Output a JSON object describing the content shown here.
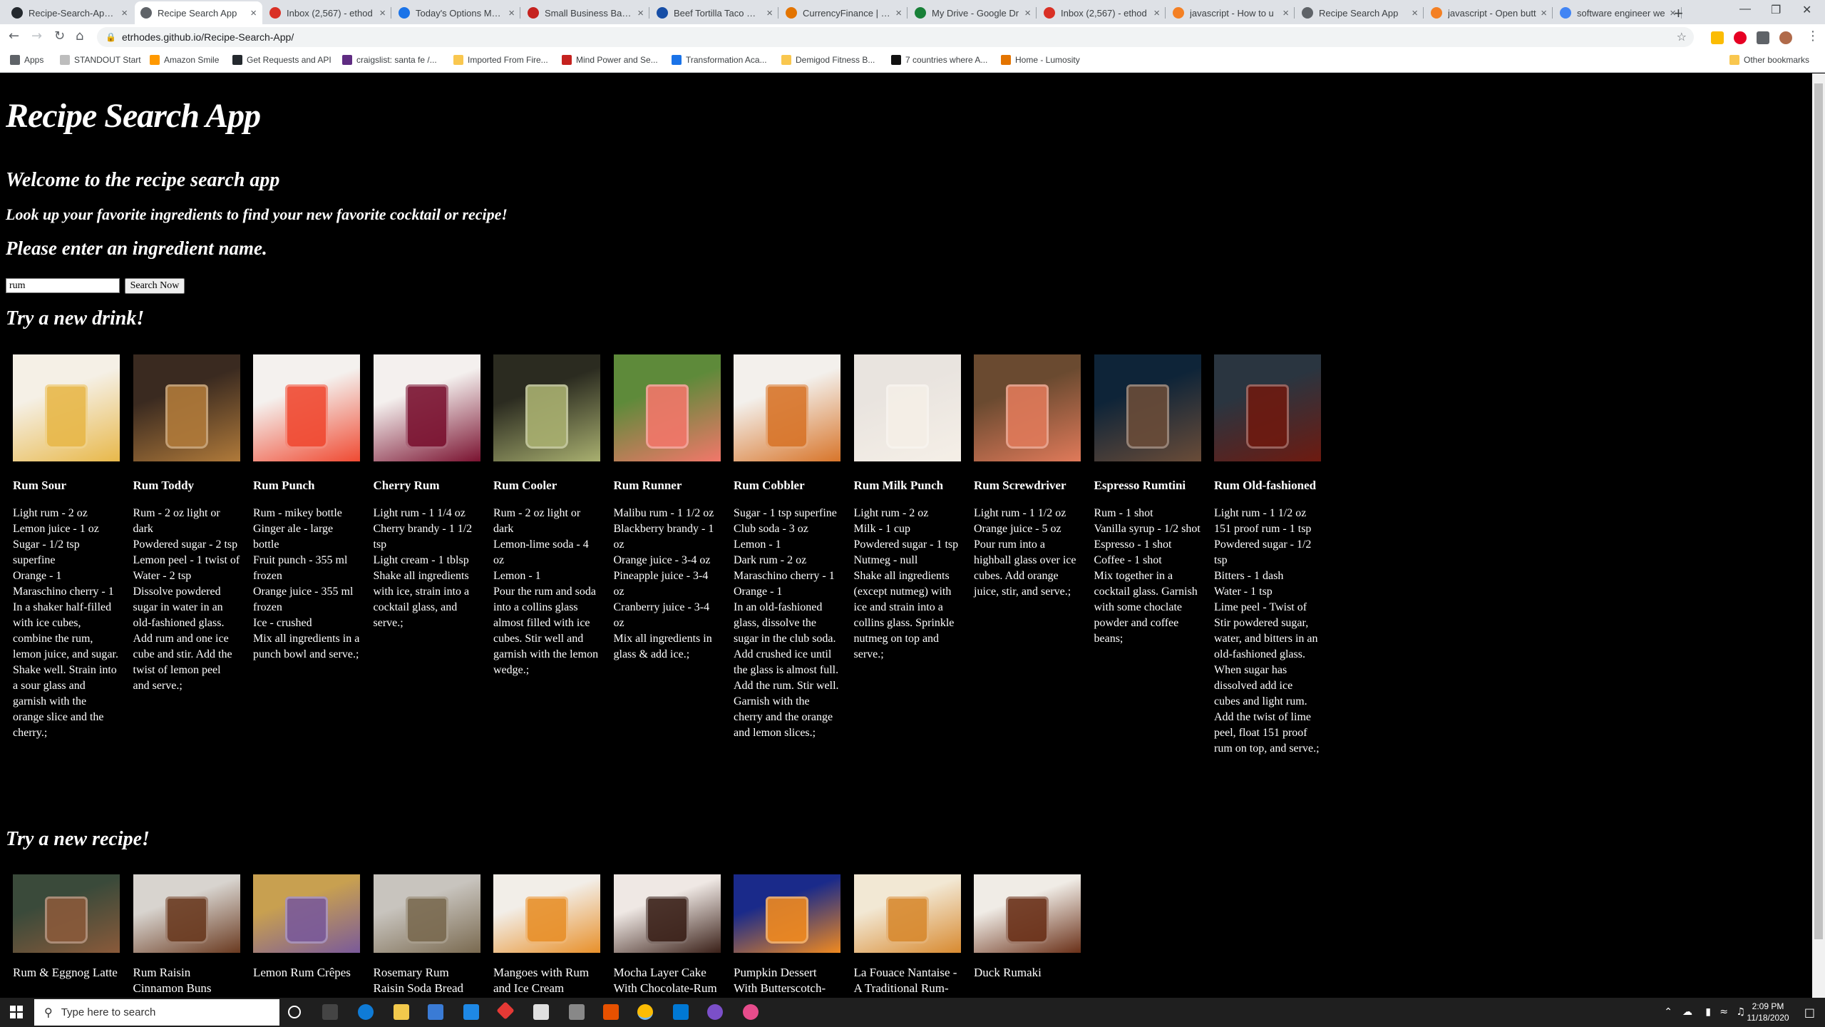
{
  "browser": {
    "tabs": [
      {
        "title": "Recipe-Search-App/R",
        "color": "#24292e"
      },
      {
        "title": "Recipe Search App",
        "color": "#5f6368"
      },
      {
        "title": "Inbox (2,567) - ethod",
        "color": "#d93025"
      },
      {
        "title": "Today's Options Mark",
        "color": "#1a73e8"
      },
      {
        "title": "Small Business Bankin",
        "color": "#c5221f"
      },
      {
        "title": "Beef Tortilla Taco Cas",
        "color": "#174ea6"
      },
      {
        "title": "CurrencyFinance | On",
        "color": "#e37400"
      },
      {
        "title": "My Drive - Google Dr",
        "color": "#188038"
      },
      {
        "title": "Inbox (2,567) - ethod",
        "color": "#d93025"
      },
      {
        "title": "javascript - How to u",
        "color": "#f48024"
      },
      {
        "title": "Recipe Search App",
        "color": "#5f6368"
      },
      {
        "title": "javascript - Open butt",
        "color": "#f48024"
      },
      {
        "title": "software engineer we",
        "color": "#4285f4"
      }
    ],
    "url": "etrhodes.github.io/Recipe-Search-App/",
    "bookmarks": [
      {
        "label": "Apps",
        "color": "#5f6368"
      },
      {
        "label": "STANDOUT Start",
        "color": "#bdbdbd"
      },
      {
        "label": "Amazon Smile",
        "color": "#ff9900"
      },
      {
        "label": "Get Requests and API",
        "color": "#24292e"
      },
      {
        "label": "craigslist: santa fe /...",
        "color": "#5f2c82"
      },
      {
        "label": "Imported From Fire...",
        "color": "#f9c74f"
      },
      {
        "label": "Mind Power and Se...",
        "color": "#c5221f"
      },
      {
        "label": "Transformation Aca...",
        "color": "#1a73e8"
      },
      {
        "label": "Demigod Fitness B...",
        "color": "#f9c74f"
      },
      {
        "label": "7 countries where A...",
        "color": "#111111"
      },
      {
        "label": "Home - Lumosity",
        "color": "#e37400"
      }
    ],
    "other_bookmarks": "Other bookmarks"
  },
  "page": {
    "title": "Recipe Search App",
    "welcome": "Welcome to the recipe search app",
    "lookup": "Look up your favorite ingredients to find your new favorite cocktail or recipe!",
    "prompt": "Please enter an ingredient name.",
    "search_value": "rum",
    "search_button": "Search Now",
    "drinks_heading": "Try a new drink!",
    "recipes_heading": "Try a new recipe!"
  },
  "drinks": [
    {
      "name": "Rum Sour",
      "recipe": "Light rum - 2 oz\nLemon juice - 1 oz\nSugar - 1/2 tsp superfine\nOrange - 1\nMaraschino cherry - 1\nIn a shaker half-filled with ice cubes, combine the rum, lemon juice, and sugar. Shake well. Strain into a sour glass and garnish with the orange slice and the cherry.;",
      "img": [
        "#f5f0e6",
        "#e8b84a"
      ]
    },
    {
      "name": "Rum Toddy",
      "recipe": "Rum - 2 oz light or dark\nPowdered sugar - 2 tsp\nLemon peel - 1 twist of\nWater - 2 tsp\nDissolve powdered sugar in water in an old-fashioned glass. Add rum and one ice cube and stir. Add the twist of lemon peel and serve.;",
      "img": [
        "#3a2a20",
        "#b07a3a"
      ]
    },
    {
      "name": "Rum Punch",
      "recipe": "Rum - mikey bottle\nGinger ale - large bottle\nFruit punch - 355 ml frozen\nOrange juice - 355 ml frozen\nIce - crushed\nMix all ingredients in a punch bowl and serve.;",
      "img": [
        "#f4f1ee",
        "#f04a32"
      ]
    },
    {
      "name": "Cherry Rum",
      "recipe": "Light rum - 1 1/4 oz\nCherry brandy - 1 1/2 tsp\nLight cream - 1 tblsp\nShake all ingredients with ice, strain into a cocktail glass, and serve.;",
      "img": [
        "#f4f0ee",
        "#7a1230"
      ]
    },
    {
      "name": "Rum Cooler",
      "recipe": "Rum - 2 oz light or dark\nLemon-lime soda - 4 oz\nLemon - 1\nPour the rum and soda into a collins glass almost filled with ice cubes. Stir well and garnish with the lemon wedge.;",
      "img": [
        "#2b2b20",
        "#a9b070"
      ]
    },
    {
      "name": "Rum Runner",
      "recipe": "Malibu rum - 1 1/2 oz\nBlackberry brandy - 1 oz\nOrange juice - 3-4 oz\nPineapple juice - 3-4 oz\nCranberry juice - 3-4 oz\nMix all ingredients in glass & add ice.;",
      "img": [
        "#5e8a3a",
        "#f2776a"
      ]
    },
    {
      "name": "Rum Cobbler",
      "recipe": "Sugar - 1 tsp superfine\nClub soda - 3 oz\nLemon - 1\nDark rum - 2 oz\nMaraschino cherry - 1\nOrange - 1\nIn an old-fashioned glass, dissolve the sugar in the club soda. Add crushed ice until the glass is almost full. Add the rum. Stir well. Garnish with the cherry and the orange and lemon slices.;",
      "img": [
        "#f3f0ec",
        "#d8752a"
      ]
    },
    {
      "name": "Rum Milk Punch",
      "recipe": "Light rum - 2 oz\nMilk - 1 cup\nPowdered sugar - 1 tsp\nNutmeg - null\nShake all ingredients (except nutmeg) with ice and strain into a collins glass. Sprinkle nutmeg on top and serve.;",
      "img": [
        "#e9e4df",
        "#f5efe7"
      ]
    },
    {
      "name": "Rum Screwdriver",
      "recipe": "Light rum - 1 1/2 oz\nOrange juice - 5 oz\nPour rum into a highball glass over ice cubes. Add orange juice, stir, and serve.;",
      "img": [
        "#6a4a30",
        "#e07a5a"
      ]
    },
    {
      "name": "Espresso Rumtini",
      "recipe": "Rum - 1 shot\nVanilla syrup - 1/2 shot\nEspresso - 1 shot\nCoffee - 1 shot\nMix together in a cocktail glass. Garnish with some choclate powder and coffee beans;",
      "img": [
        "#0e2438",
        "#6a4c38"
      ]
    },
    {
      "name": "Rum Old-fashioned",
      "recipe": "Light rum - 1 1/2 oz\n151 proof rum - 1 tsp\nPowdered sugar - 1/2 tsp\nBitters - 1 dash\nWater - 1 tsp\nLime peel - Twist of\nStir powdered sugar, water, and bitters in an old-fashioned glass. When sugar has dissolved add ice cubes and light rum. Add the twist of lime peel, float 151 proof rum on top, and serve.;",
      "img": [
        "#2a3540",
        "#6e1a10"
      ]
    }
  ],
  "recipes": [
    {
      "name": "Rum & Eggnog Latte",
      "img": [
        "#3a4a3a",
        "#8a5a3a"
      ]
    },
    {
      "name": "Rum Raisin Cinnamon Buns",
      "img": [
        "#d8d4cf",
        "#6a3a20"
      ]
    },
    {
      "name": "Lemon Rum Crêpes",
      "img": [
        "#c8a050",
        "#7a5a9a"
      ]
    },
    {
      "name": "Rosemary Rum Raisin Soda Bread",
      "img": [
        "#c8c4be",
        "#7a6a50"
      ]
    },
    {
      "name": "Mangoes with Rum and Ice Cream",
      "img": [
        "#f2eee8",
        "#e8902a"
      ]
    },
    {
      "name": "Mocha Layer Cake With Chocolate-Rum",
      "img": [
        "#efe8e4",
        "#3a2018"
      ]
    },
    {
      "name": "Pumpkin Dessert With Butterscotch-",
      "img": [
        "#1a2a8a",
        "#f08a20"
      ]
    },
    {
      "name": "La Fouace Nantaise - A Traditional Rum-",
      "img": [
        "#f2e8d4",
        "#d88a30"
      ]
    },
    {
      "name": "Duck Rumaki",
      "img": [
        "#f0ece6",
        "#6a3018"
      ]
    }
  ],
  "taskbar": {
    "search_placeholder": "Type here to search",
    "time": "2:09 PM",
    "date": "11/18/2020"
  }
}
